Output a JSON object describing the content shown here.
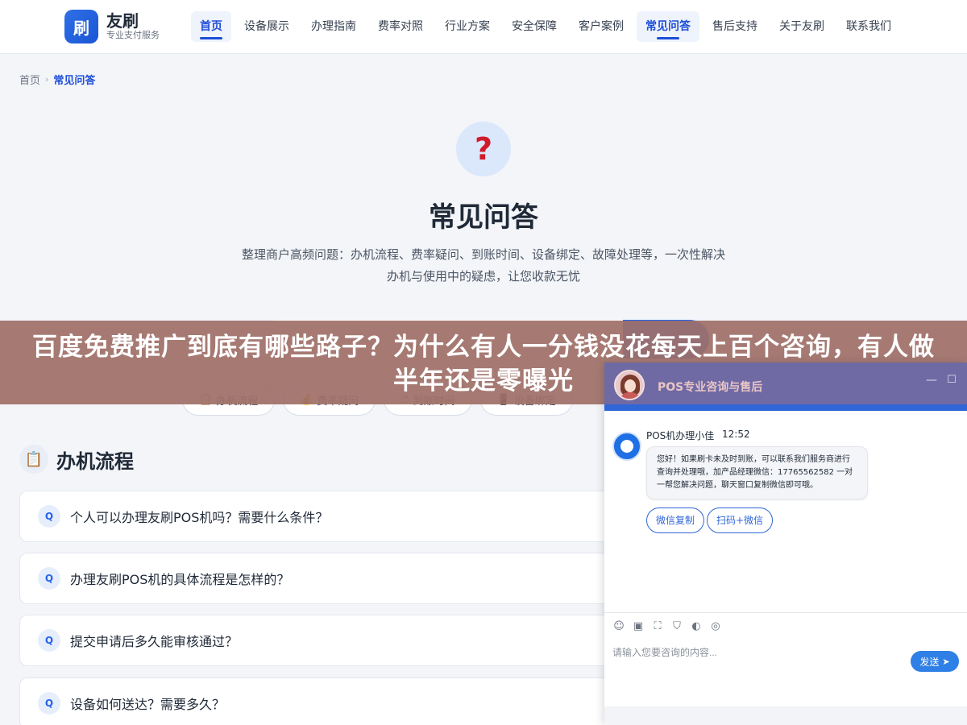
{
  "brand": {
    "logo_char": "刷",
    "name": "友刷",
    "tagline": "专业支付服务"
  },
  "nav": {
    "items": [
      {
        "label": "首页",
        "active": true
      },
      {
        "label": "设备展示",
        "active": false
      },
      {
        "label": "办理指南",
        "active": false
      },
      {
        "label": "费率对照",
        "active": false
      },
      {
        "label": "行业方案",
        "active": false
      },
      {
        "label": "安全保障",
        "active": false
      },
      {
        "label": "客户案例",
        "active": false
      },
      {
        "label": "常见问答",
        "active": true
      },
      {
        "label": "售后支持",
        "active": false
      },
      {
        "label": "关于友刷",
        "active": false
      },
      {
        "label": "联系我们",
        "active": false
      }
    ]
  },
  "breadcrumb": {
    "home": "首页",
    "separator": "›",
    "current": "常见问答"
  },
  "hero": {
    "icon": "question-mark-icon",
    "title": "常见问答",
    "description": "整理商户高频问题：办机流程、费率疑问、到账时间、设备绑定、故障处理等，一次性解决办机与使用中的疑虑，让您收款无忧"
  },
  "categories": [
    {
      "label": "办机流程",
      "icon": "clipboard-icon"
    },
    {
      "label": "费率疑问",
      "icon": "money-bag-icon"
    },
    {
      "label": "到账时间",
      "icon": "stopwatch-icon"
    },
    {
      "label": "设备绑定",
      "icon": "mobile-phone-icon"
    }
  ],
  "section": {
    "icon": "clipboard-icon",
    "title": "办机流程"
  },
  "faqs": [
    {
      "badge": "Q",
      "question": "个人可以办理友刷POS机吗？需要什么条件？"
    },
    {
      "badge": "Q",
      "question": "办理友刷POS机的具体流程是怎样的？"
    },
    {
      "badge": "Q",
      "question": "提交申请后多久能审核通过？"
    },
    {
      "badge": "Q",
      "question": "设备如何送达？需要多久？"
    }
  ],
  "banner": {
    "text": "百度免费推广到底有哪些路子？为什么有人一分钱没花每天上百个咨询，有人做半年还是零曝光"
  },
  "chat": {
    "title": "POS专业咨询与售后",
    "minimize": "—",
    "maximize": "☐",
    "agent_name": "POS机办理小佳",
    "time": "12:52",
    "message": "您好！如果刷卡未及时到账，可以联系我们服务商进行查询并处理哦，加产品经理微信：17765562582 一对一帮您解决问题，聊天窗口复制微信即可哦。",
    "buttons": [
      "微信复制",
      "扫码+微信"
    ],
    "tools": [
      "emoji-icon",
      "image-icon",
      "screenshot-icon",
      "shield-icon",
      "voice-icon",
      "wechat-icon"
    ],
    "input_placeholder": "请输入您要咨询的内容...",
    "send_label": "发送"
  },
  "colors": {
    "primary": "#1d4ed8",
    "chat_header": "#6f6aa4",
    "banner": "#9f7068"
  }
}
